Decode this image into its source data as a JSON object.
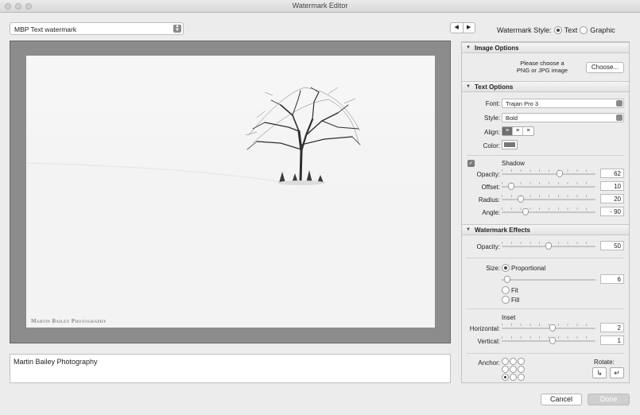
{
  "window": {
    "title": "Watermark Editor"
  },
  "preset": {
    "value": "MBP Text watermark"
  },
  "nav": {
    "prev": "◀",
    "next": "▶"
  },
  "watermark_style": {
    "label": "Watermark Style:",
    "options": [
      "Text",
      "Graphic"
    ],
    "selected": "Text"
  },
  "preview": {
    "watermark_text": "Martin Bailey Photography"
  },
  "text_input": {
    "value": "Martin Bailey Photography"
  },
  "image_options": {
    "header": "Image Options",
    "prompt_line1": "Please choose a",
    "prompt_line2": "PNG or JPG image",
    "choose_button": "Choose..."
  },
  "text_options": {
    "header": "Text Options",
    "font_label": "Font:",
    "font_value": "Trajan Pro 3",
    "style_label": "Style:",
    "style_value": "Bold",
    "align_label": "Align:",
    "align_selected": "left",
    "color_label": "Color:",
    "color_value": "#777777"
  },
  "shadow": {
    "label": "Shadow",
    "enabled": true,
    "opacity_label": "Opacity:",
    "opacity": "62",
    "opacity_frac": 0.62,
    "offset_label": "Offset:",
    "offset": "10",
    "offset_frac": 0.1,
    "radius_label": "Radius:",
    "radius": "20",
    "radius_frac": 0.2,
    "angle_label": "Angle:",
    "angle": "- 90",
    "angle_frac": 0.25
  },
  "watermark_effects": {
    "header": "Watermark Effects",
    "opacity_label": "Opacity:",
    "opacity": "50",
    "opacity_frac": 0.5,
    "size_label": "Size:",
    "size_options": [
      "Proportional",
      "Fit",
      "Fill"
    ],
    "size_selected": "Proportional",
    "size_value": "6",
    "size_frac": 0.06,
    "inset_label": "Inset",
    "horizontal_label": "Horizontal:",
    "horizontal": "2",
    "horizontal_frac": 0.54,
    "vertical_label": "Vertical:",
    "vertical": "1",
    "vertical_frac": 0.54,
    "anchor_label": "Anchor:",
    "anchor_selected": "bottom-left",
    "rotate_label": "Rotate:"
  },
  "footer": {
    "cancel": "Cancel",
    "done": "Done"
  }
}
